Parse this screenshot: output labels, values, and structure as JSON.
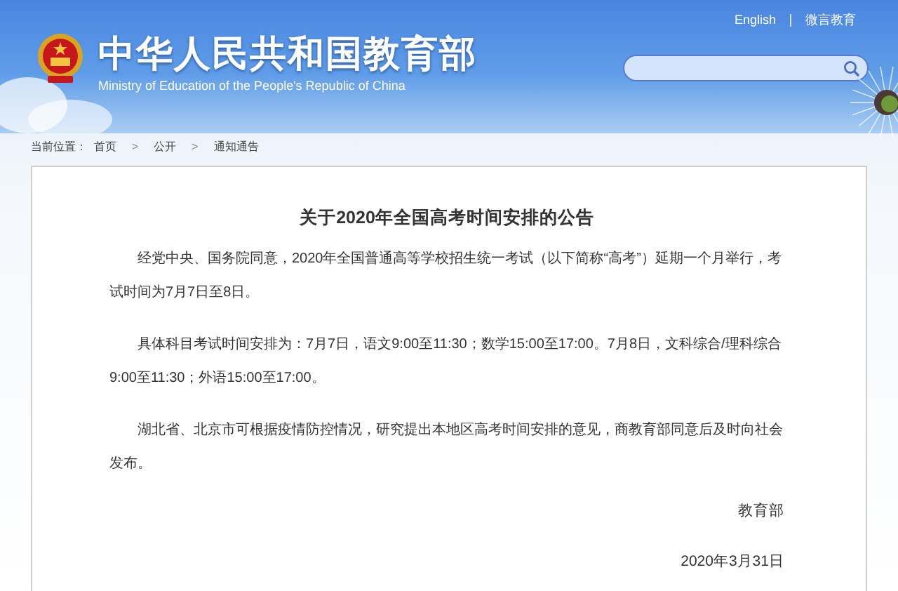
{
  "header": {
    "title": "中华人民共和国教育部",
    "subtitle": "Ministry of Education of the People's Republic of China",
    "links": [
      "English",
      "微言教育"
    ]
  },
  "breadcrumb": {
    "label": "当前位置：",
    "items": [
      {
        "kind": "link",
        "text": "首页"
      },
      {
        "kind": "separator",
        "text": ">"
      },
      {
        "kind": "link",
        "text": "公开"
      },
      {
        "kind": "separator",
        "text": ">"
      },
      {
        "kind": "link",
        "text": "通知通告"
      }
    ]
  },
  "article": {
    "title": "关于2020年全国高考时间安排的公告",
    "paragraphs": [
      "经党中央、国务院同意，2020年全国普通高等学校招生统一考试（以下简称“高考”）延期一个月举行，考试时间为7月7日至8日。",
      "具体科目考试时间安排为：7月7日，语文9:00至11:30；数学15:00至17:00。7月8日，文科综合/理科综合9:00至11:30；外语15:00至17:00。",
      "湖北省、北京市可根据疫情防控情况，研究提出本地区高考时间安排的意见，商教育部同意后及时向社会发布。"
    ],
    "signature": "教育部",
    "date": "2020年3月31日"
  }
}
